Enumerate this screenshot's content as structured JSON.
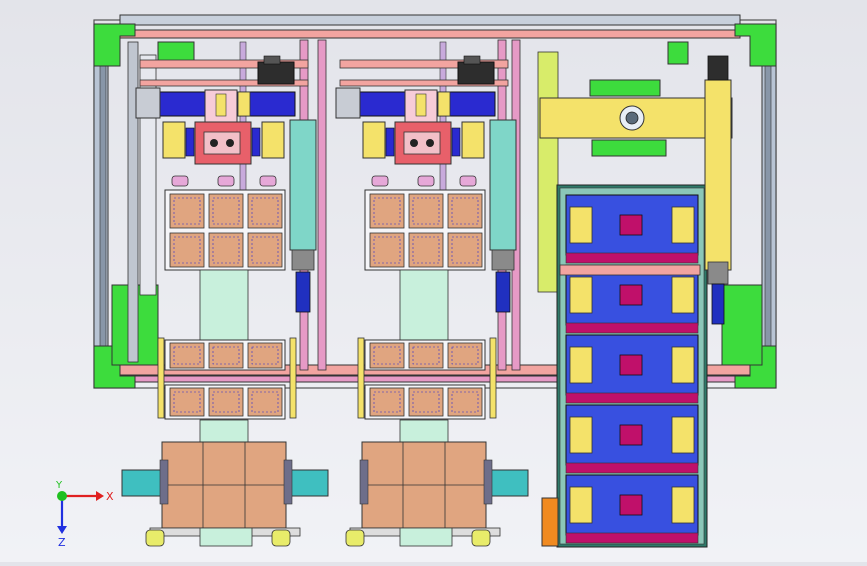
{
  "viewport": {
    "background_top": "#e3e4ea",
    "background_bottom": "#f1f2f6"
  },
  "model": {
    "type": "cad-assembly-top-view",
    "modules": [
      {
        "id": "left-pick-module"
      },
      {
        "id": "middle-pick-module"
      }
    ],
    "conveyor": {
      "id": "right-conveyor-module",
      "carriers": 5
    },
    "colors": {
      "frame": "#b8c4d4",
      "rail_salmon": "#f2a4a0",
      "rail_pink": "#e69ac6",
      "corner_green": "#3ddc3d",
      "block_blue": "#2a2ad0",
      "block_yellow": "#f4e26a",
      "tray_copper": "#e0a580",
      "cylinder_teal": "#7fd6c8",
      "carrier_blue": "#3850e0",
      "carrier_magenta": "#c0106a",
      "cyan_slider": "#3fbfc0",
      "accent_orange": "#f08a20"
    }
  },
  "triad": {
    "x_label": "X",
    "y_label": "Y",
    "z_label": "Z",
    "x_color": "#e02020",
    "y_color": "#20c020",
    "z_color": "#2030e0"
  }
}
